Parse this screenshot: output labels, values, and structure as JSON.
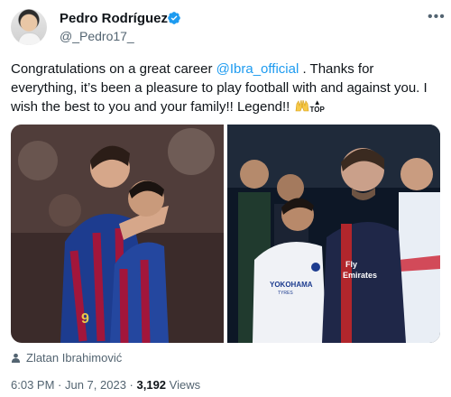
{
  "author": {
    "name": "Pedro Rodríguez",
    "handle": "@_Pedro17_",
    "avatar": "avatar-photo",
    "verified_icon": "verified-badge-icon",
    "verified_color": "#1d9bf0"
  },
  "tweet": {
    "text_part1": "Congratulations on a great career ",
    "mention": "@Ibra_official",
    "text_part2": " . Thanks for everything, it’s been a pleasure to play football with and against you. I wish the best to you and your family!! Legend!! ",
    "emoji_top": "TOP"
  },
  "media": {
    "left_jersey_numbers": [
      "9"
    ],
    "right_jersey_text": [
      "Fly",
      "Emirates",
      "YOKOHAMA",
      "TYRES"
    ]
  },
  "tag": {
    "person": "Zlatan Ibrahimović"
  },
  "meta": {
    "time": "6:03 PM",
    "separator": " · ",
    "date": "Jun 7, 2023",
    "views_count": "3,192",
    "views_label": "Views"
  },
  "colors": {
    "text": "#0f1419",
    "secondary": "#536471",
    "accent": "#1d9bf0"
  }
}
